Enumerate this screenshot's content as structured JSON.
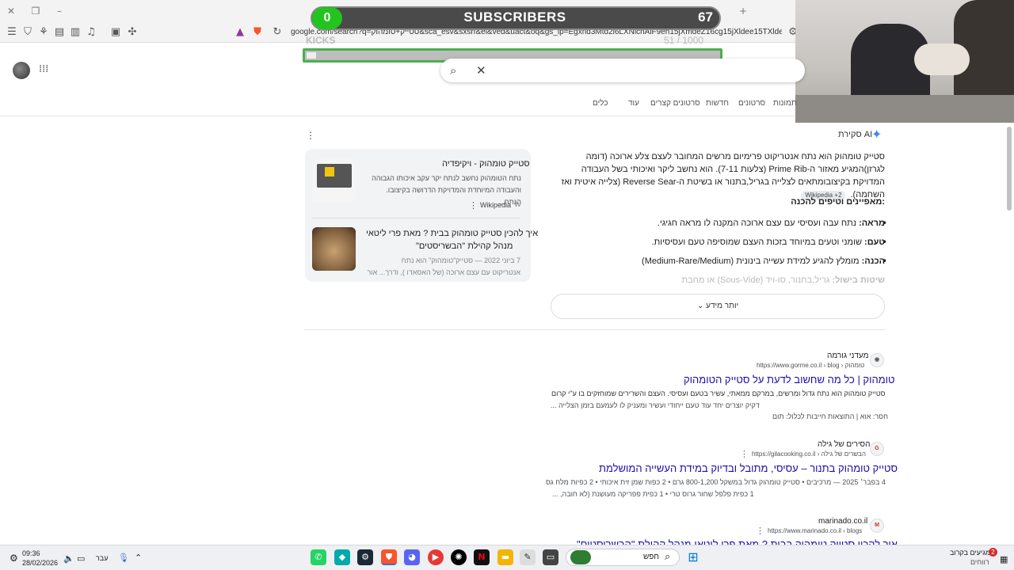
{
  "browser": {
    "url": "google.com/search?q=סטייק+טומהוק&sca_esv&sxsrf&ei&ved&uact&oq&gs_lp=Egxnd3Mtd2l6LXNlcnAiF9eh15jXmdeZ16cg15jXldee15TXldenMgUQABiABDIFEAAYgAQyBRAAGIAEMgUQABiABDIFEAAYgAQyBRAAGIAEMgUQABiABDIFEAAYgARIAFAAWABwAHgAkAEAmAEAoAEAqgEAuAEDyAEA-AEBmAIAoAIAmAMAkgcAoAcAsgcAuAcAwgcAyAcA&sclient=gws-wiz-serp&mstk=AUtExfBa0AAE"
  },
  "overlay": {
    "subscribers_label": "SUBSCRIBERS",
    "subscribers_value": "0",
    "subscribers_count": "67",
    "kicks_label": "KICKS",
    "kicks_count": "51 / 1000",
    "kicks_progress": 0.051
  },
  "search": {
    "tabs": [
      "תמונות",
      "סרטונים",
      "חדשות",
      "סרטונים קצרים",
      "עוד",
      "כלים"
    ]
  },
  "ai_overview": {
    "title": "סקירת AI",
    "paragraph": "סטייק טומהוק הוא נתח אנטריקוט פרימיום מרשים המחובר לעצם צלע ארוכה (דומה לגרזן)המגיע מאזור ה-Prime Rib (צלעות 7-11). הוא נחשב ליקר ואיכותי בשל העבודה המדויקת בקיצובומתאים לצלייה בגריל,בתנור או בשיטת ה-Reverse Sear (צלייה איטית ואז השחמה).",
    "badge": "Wikipedia +2",
    "subheading": "מאפיינים וטיפים להכנה:",
    "bullets": [
      {
        "label": "מראה:",
        "text": "נתח עבה ועסיסי עם עצם ארוכה המקנה לו מראה חגיגי."
      },
      {
        "label": "טעם:",
        "text": "שומני וטעים במיוחד בזכות העצם שמוסיפה טעם ועסיסיות."
      },
      {
        "label": "הכנה:",
        "text": "מומלץ להגיע למידת עשייה בינונית (Medium-Rare/Medium)"
      },
      {
        "label": "שיטות בישול:",
        "text": "גריל,בתנור, סו-ויד (Sous-Vide) או מחבת"
      }
    ],
    "more_label": "יותר מידע",
    "cards": [
      {
        "title": "סטייק טומהוק - ויקיפדיה",
        "desc1": "נתח הטומהוק נחשב לנתח יקר עקב איכותו הגבוהה",
        "desc2": "והעבודה המיוחדת והמדויקת הדרושה בקיצובו. הנתח...",
        "source": "Wikipedia"
      },
      {
        "title1": "איך להכין סטייק טומהוק בבית ? מאת פרי ליטאי",
        "title2": "מנהל קהילת \"הבשריסטים\"",
        "desc1": "7 ביוני 2022 — סטייק\"טומהוק\" הוא נתח",
        "desc2": "אנטריקוט עם עצם ארוכה (של האסאדו ), ודרך... אור"
      }
    ]
  },
  "results": [
    {
      "site": "מעדני גורמה",
      "url": "https://www.gorme.co.il › blog › טומהוק",
      "title": "טומהוק | כל מה שחשוב לדעת על סטייק הטומהוק",
      "snippet1": "סטייק טומהוק הוא נתח גדול ומרשים, במרקם ממאתי, עשיר בטעם ועסיסי. העצם והשרירים שמוחזקים בו ע\"י קרום",
      "snippet2": "דקיק יוצרים יחד עוד טעם ייחודי ועשיר ומעניק לו לעמעם בזמן הצלייה ...",
      "snippet3": "חסר: אוא | התוצאות חייבות לכלול: תום"
    },
    {
      "site": "הסירים של גילה",
      "url": "https://gilacooking.co.il › הבשרים של גילה",
      "title": "סטייק טומהוק בתנור – עסיסי, מתובל ובדיוק במידת העשייה המושלמת",
      "snippet1": "4 בפבר׳ 2025 — מרכיבים • סטייק טומהוק גדול במשקל 800-1,200 גרם • 2 כפות שמן זית איכותי • 2 כפיות מלח גס",
      "snippet2": "1 כפית פלפל שחור גרוס טרי • 1 כפית פפריקה מעושנת (לא חובה, ..."
    },
    {
      "site": "marinado.co.il",
      "url": "https://www.marinado.co.il › blogs",
      "title": "איך להכין סטייק טומהוק בבית ? מאת פרי ליטאי מנהל קהילת \"הבשריסטים\""
    }
  ],
  "taskbar": {
    "search_placeholder": "חפש",
    "time": "09:36",
    "date": "28/02/2026",
    "lang": "עבר",
    "news": "מגיעים בקרוב",
    "news_sub": "רווחים",
    "notif_count": "2"
  }
}
